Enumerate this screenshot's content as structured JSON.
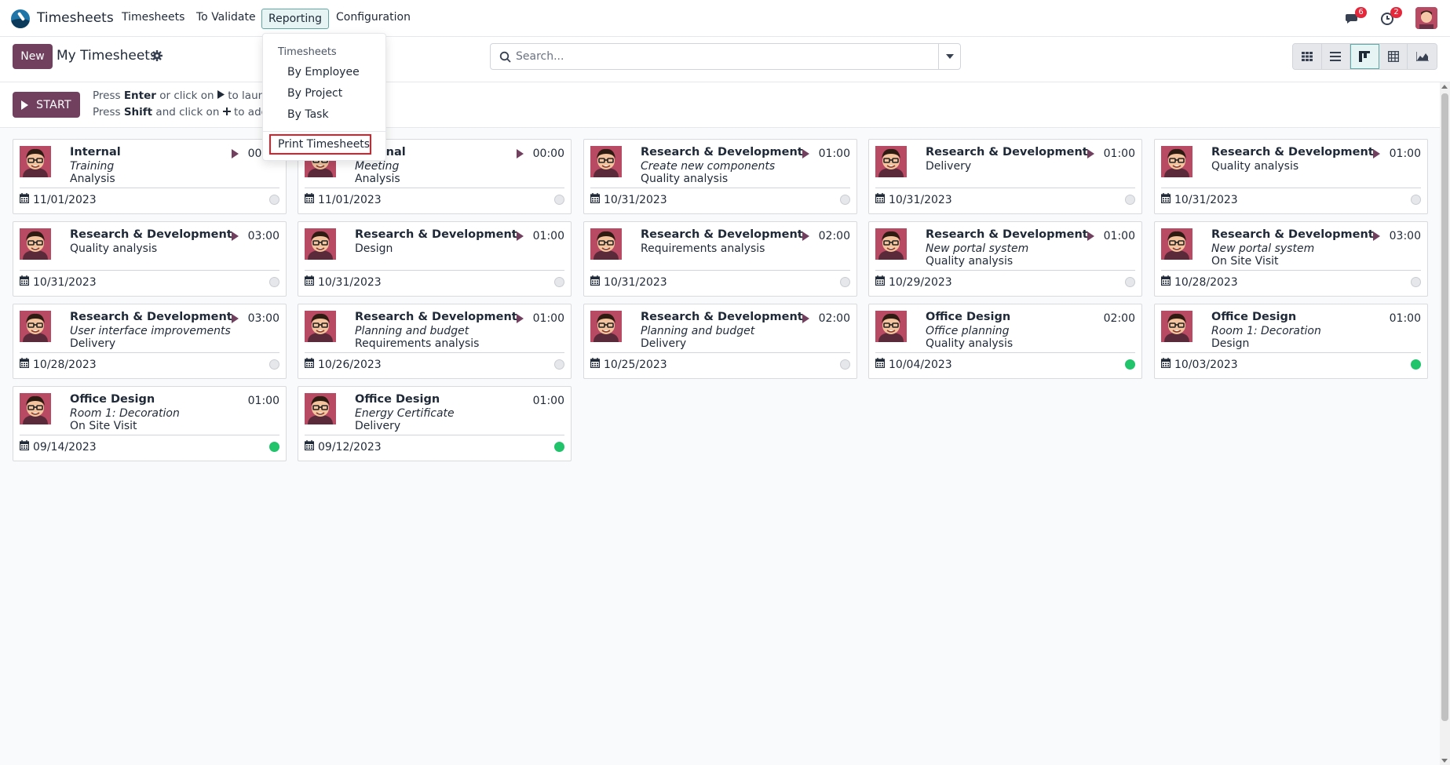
{
  "navbar": {
    "app_name": "Timesheets",
    "menu": [
      "Timesheets",
      "To Validate",
      "Reporting",
      "Configuration"
    ],
    "active_menu": "Reporting",
    "messages_badge": "6",
    "activities_badge": "2"
  },
  "control_panel": {
    "new_label": "New",
    "title": "My Timesheets",
    "search_placeholder": "Search..."
  },
  "timer": {
    "start_label": "START",
    "hint1": {
      "a": "Press ",
      "key": "Enter",
      "b": " or click on ",
      "c": " to launch"
    },
    "hint2": {
      "a": "Press ",
      "key": "Shift",
      "b": " and click on ",
      "c": " to add 1"
    }
  },
  "dropdown": {
    "header": "Timesheets",
    "items": [
      "By Employee",
      "By Project",
      "By Task"
    ],
    "print_label": "Print Timesheets"
  },
  "cards": [
    {
      "project": "Internal",
      "task": "Training",
      "desc": "Analysis",
      "duration": "00:00",
      "date": "11/01/2023",
      "play": true,
      "status": "grey"
    },
    {
      "project": "Internal",
      "task": "Meeting",
      "desc": "Analysis",
      "duration": "00:00",
      "date": "11/01/2023",
      "play": true,
      "status": "grey"
    },
    {
      "project": "Research & Development",
      "task": "Create new components",
      "desc": "Quality analysis",
      "duration": "01:00",
      "date": "10/31/2023",
      "play": true,
      "status": "grey"
    },
    {
      "project": "Research & Development",
      "task": "",
      "desc": "Delivery",
      "duration": "01:00",
      "date": "10/31/2023",
      "play": true,
      "status": "grey"
    },
    {
      "project": "Research & Development",
      "task": "",
      "desc": "Quality analysis",
      "duration": "01:00",
      "date": "10/31/2023",
      "play": true,
      "status": "grey"
    },
    {
      "project": "Research & Development",
      "task": "",
      "desc": "Quality analysis",
      "duration": "03:00",
      "date": "10/31/2023",
      "play": true,
      "status": "grey"
    },
    {
      "project": "Research & Development",
      "task": "",
      "desc": "Design",
      "duration": "01:00",
      "date": "10/31/2023",
      "play": true,
      "status": "grey"
    },
    {
      "project": "Research & Development",
      "task": "",
      "desc": "Requirements analysis",
      "duration": "02:00",
      "date": "10/31/2023",
      "play": true,
      "status": "grey"
    },
    {
      "project": "Research & Development",
      "task": "New portal system",
      "desc": "Quality analysis",
      "duration": "01:00",
      "date": "10/29/2023",
      "play": true,
      "status": "grey"
    },
    {
      "project": "Research & Development",
      "task": "New portal system",
      "desc": "On Site Visit",
      "duration": "03:00",
      "date": "10/28/2023",
      "play": true,
      "status": "grey"
    },
    {
      "project": "Research & Development",
      "task": "User interface improvements",
      "desc": "Delivery",
      "duration": "03:00",
      "date": "10/28/2023",
      "play": true,
      "status": "grey"
    },
    {
      "project": "Research & Development",
      "task": "Planning and budget",
      "desc": "Requirements analysis",
      "duration": "01:00",
      "date": "10/26/2023",
      "play": true,
      "status": "grey"
    },
    {
      "project": "Research & Development",
      "task": "Planning and budget",
      "desc": "Delivery",
      "duration": "02:00",
      "date": "10/25/2023",
      "play": true,
      "status": "grey"
    },
    {
      "project": "Office Design",
      "task": "Office planning",
      "desc": "Quality analysis",
      "duration": "02:00",
      "date": "10/04/2023",
      "play": false,
      "status": "green"
    },
    {
      "project": "Office Design",
      "task": "Room 1: Decoration",
      "desc": "Design",
      "duration": "01:00",
      "date": "10/03/2023",
      "play": false,
      "status": "green"
    },
    {
      "project": "Office Design",
      "task": "Room 1: Decoration",
      "desc": "On Site Visit",
      "duration": "01:00",
      "date": "09/14/2023",
      "play": false,
      "status": "green"
    },
    {
      "project": "Office Design",
      "task": "Energy Certificate",
      "desc": "Delivery",
      "duration": "01:00",
      "date": "09/12/2023",
      "play": false,
      "status": "green"
    }
  ],
  "colors": {
    "brand": "#71405f",
    "active_border": "#5fa8a8",
    "validated": "#21c36b",
    "highlight": "#e01e2a"
  }
}
